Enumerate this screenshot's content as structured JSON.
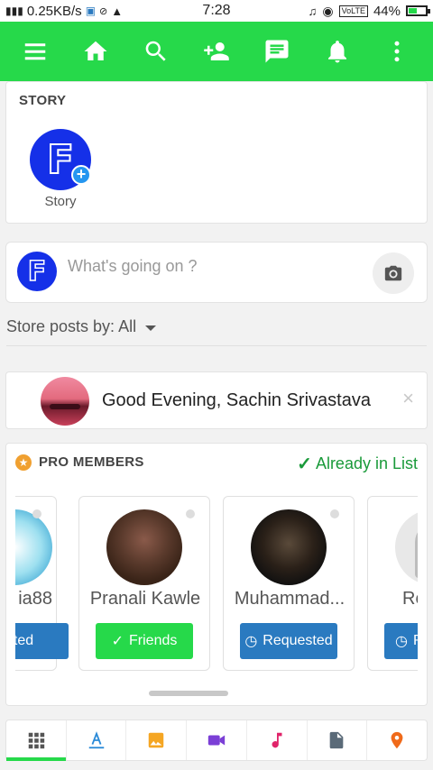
{
  "status_bar": {
    "network_speed": "0.25KB/s",
    "time": "7:28",
    "volte": "VoLTE",
    "battery_percent": "44%",
    "battery_level": 0.44
  },
  "toolbar": {
    "icons": [
      "menu-icon",
      "home-icon",
      "search-icon",
      "add-friend-icon",
      "messages-icon",
      "notifications-icon",
      "more-vert-icon"
    ],
    "color": "#26d94a"
  },
  "story": {
    "title": "STORY",
    "items": [
      {
        "label": "Story",
        "avatar_letter": "F"
      }
    ]
  },
  "composer": {
    "avatar_letter": "F",
    "placeholder": "What's going on ?"
  },
  "sort": {
    "label": "Store posts by: All"
  },
  "greeting": {
    "text": "Good Evening, Sachin Srivastava",
    "close": "×"
  },
  "pro_members": {
    "title": "PRO MEMBERS",
    "status": "Already in List",
    "members": [
      {
        "name": "ia88",
        "button": "sted",
        "style": "blue"
      },
      {
        "name": "Pranali Kawle",
        "button": "Friends",
        "style": "green"
      },
      {
        "name": "Muhammad...",
        "button": "Requested",
        "style": "blue"
      },
      {
        "name": "Re",
        "button": "Re",
        "style": "blue"
      }
    ]
  },
  "bottom_tabs": {
    "items": [
      "grid-icon",
      "text-icon",
      "image-icon",
      "video-icon",
      "music-icon",
      "file-icon",
      "location-icon"
    ],
    "active_index": 0
  },
  "colors": {
    "brand_green": "#26d94a",
    "brand_blue": "#1530e8",
    "button_blue": "#2a7ac0",
    "list_green": "#1a9a3a"
  }
}
